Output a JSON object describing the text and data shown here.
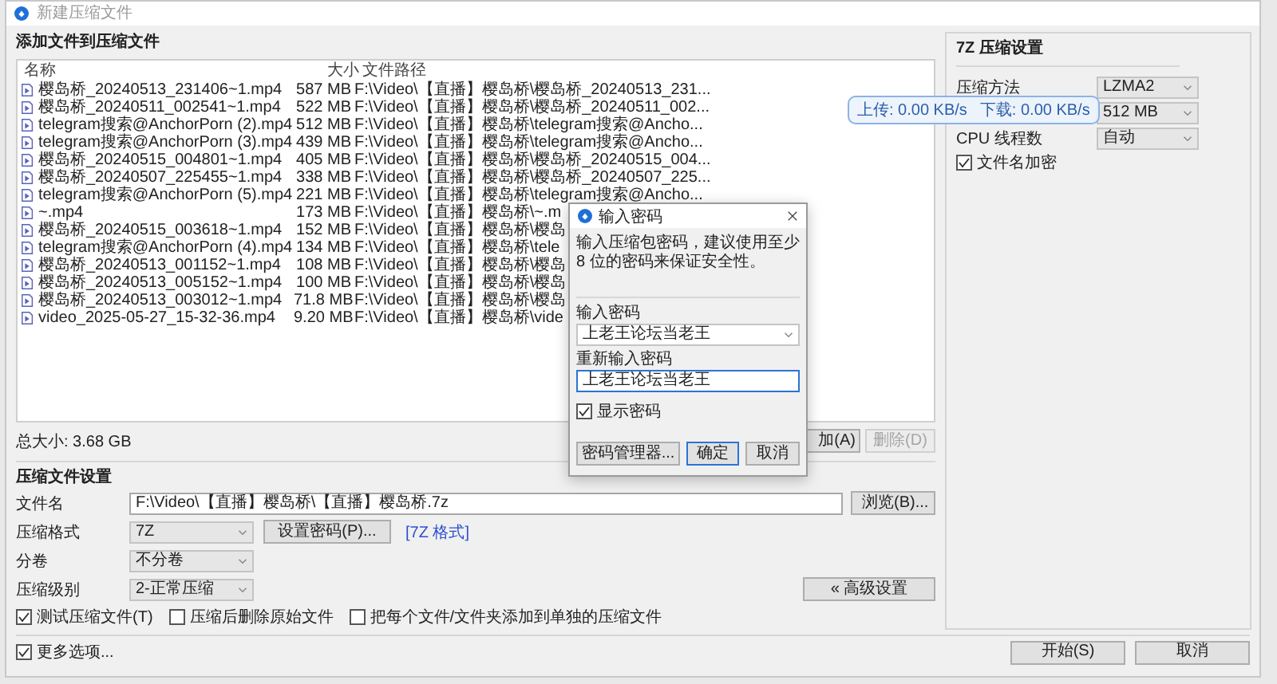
{
  "window": {
    "title": "新建压缩文件"
  },
  "files": {
    "heading": "添加文件到压缩文件",
    "columns": [
      "名称",
      "大小",
      "文件路径"
    ],
    "rows": [
      {
        "name": "樱岛桥_20240513_231406~1.mp4",
        "size": "587 MB",
        "path": "F:\\Video\\【直播】樱岛桥\\樱岛桥_20240513_231..."
      },
      {
        "name": "樱岛桥_20240511_002541~1.mp4",
        "size": "522 MB",
        "path": "F:\\Video\\【直播】樱岛桥\\樱岛桥_20240511_002..."
      },
      {
        "name": "telegram搜索@AnchorPorn (2).mp4",
        "size": "512 MB",
        "path": "F:\\Video\\【直播】樱岛桥\\telegram搜索@Ancho..."
      },
      {
        "name": "telegram搜索@AnchorPorn (3).mp4",
        "size": "439 MB",
        "path": "F:\\Video\\【直播】樱岛桥\\telegram搜索@Ancho..."
      },
      {
        "name": "樱岛桥_20240515_004801~1.mp4",
        "size": "405 MB",
        "path": "F:\\Video\\【直播】樱岛桥\\樱岛桥_20240515_004..."
      },
      {
        "name": "樱岛桥_20240507_225455~1.mp4",
        "size": "338 MB",
        "path": "F:\\Video\\【直播】樱岛桥\\樱岛桥_20240507_225..."
      },
      {
        "name": "telegram搜索@AnchorPorn (5).mp4",
        "size": "221 MB",
        "path": "F:\\Video\\【直播】樱岛桥\\telegram搜索@Ancho..."
      },
      {
        "name": "~.mp4",
        "size": "173 MB",
        "path": "F:\\Video\\【直播】樱岛桥\\~.m"
      },
      {
        "name": "樱岛桥_20240515_003618~1.mp4",
        "size": "152 MB",
        "path": "F:\\Video\\【直播】樱岛桥\\樱岛"
      },
      {
        "name": "telegram搜索@AnchorPorn (4).mp4",
        "size": "134 MB",
        "path": "F:\\Video\\【直播】樱岛桥\\tele"
      },
      {
        "name": "樱岛桥_20240513_001152~1.mp4",
        "size": "108 MB",
        "path": "F:\\Video\\【直播】樱岛桥\\樱岛"
      },
      {
        "name": "樱岛桥_20240513_005152~1.mp4",
        "size": "100 MB",
        "path": "F:\\Video\\【直播】樱岛桥\\樱岛"
      },
      {
        "name": "樱岛桥_20240513_003012~1.mp4",
        "size": "71.8 MB",
        "path": "F:\\Video\\【直播】樱岛桥\\樱岛"
      },
      {
        "name": "video_2025-05-27_15-32-36.mp4",
        "size": "9.20 MB",
        "path": "F:\\Video\\【直播】樱岛桥\\vide"
      }
    ],
    "total": "总大小: 3.68 GB",
    "buttons": [
      {
        "label": "加(A)",
        "disabled": false
      },
      {
        "label": "删除(D)",
        "disabled": true
      }
    ]
  },
  "settings": {
    "heading": "压缩文件设置",
    "filename_label": "文件名",
    "filename": "F:\\Video\\【直播】樱岛桥\\【直播】樱岛桥.7z",
    "browse": "浏览(B)...",
    "format_label": "压缩格式",
    "format": "7Z",
    "set_password": "设置密码(P)...",
    "format_link": "[7Z 格式]",
    "volume_label": "分卷",
    "volume": "不分卷",
    "level_label": "压缩级别",
    "level": "2-正常压缩",
    "advanced": "« 高级设置",
    "options": [
      {
        "label": "测试压缩文件(T)",
        "checked": true
      },
      {
        "label": "压缩后删除原始文件",
        "checked": false
      },
      {
        "label": "把每个文件/文件夹添加到单独的压缩文件",
        "checked": false
      }
    ]
  },
  "seven_zip": {
    "heading": "7Z 压缩设置",
    "rows": [
      {
        "label": "压缩方法",
        "value": "LZMA2"
      },
      {
        "value": "512 MB"
      },
      {
        "label": "CPU 线程数",
        "value": "自动"
      }
    ],
    "encrypt_names": {
      "label": "文件名加密",
      "checked": true
    }
  },
  "footer": {
    "more": {
      "label": "更多选项...",
      "checked": true
    },
    "buttons": [
      "开始(S)",
      "取消"
    ]
  },
  "dialog": {
    "title": "输入密码",
    "message": "输入压缩包密码，建议使用至少 8 位的密码来保证安全性。",
    "password_label": "输入密码",
    "password": "上老王论坛当老王",
    "confirm_label": "重新输入密码",
    "confirm": "上老王论坛当老王",
    "show_password": {
      "label": "显示密码",
      "checked": true
    },
    "buttons": [
      {
        "label": "密码管理器...",
        "default": false
      },
      {
        "label": "确定",
        "default": true
      },
      {
        "label": "取消",
        "default": false
      }
    ]
  },
  "tooltip": {
    "upload": "上传: 0.00 KB/s",
    "download": "下载: 0.00 KB/s"
  }
}
